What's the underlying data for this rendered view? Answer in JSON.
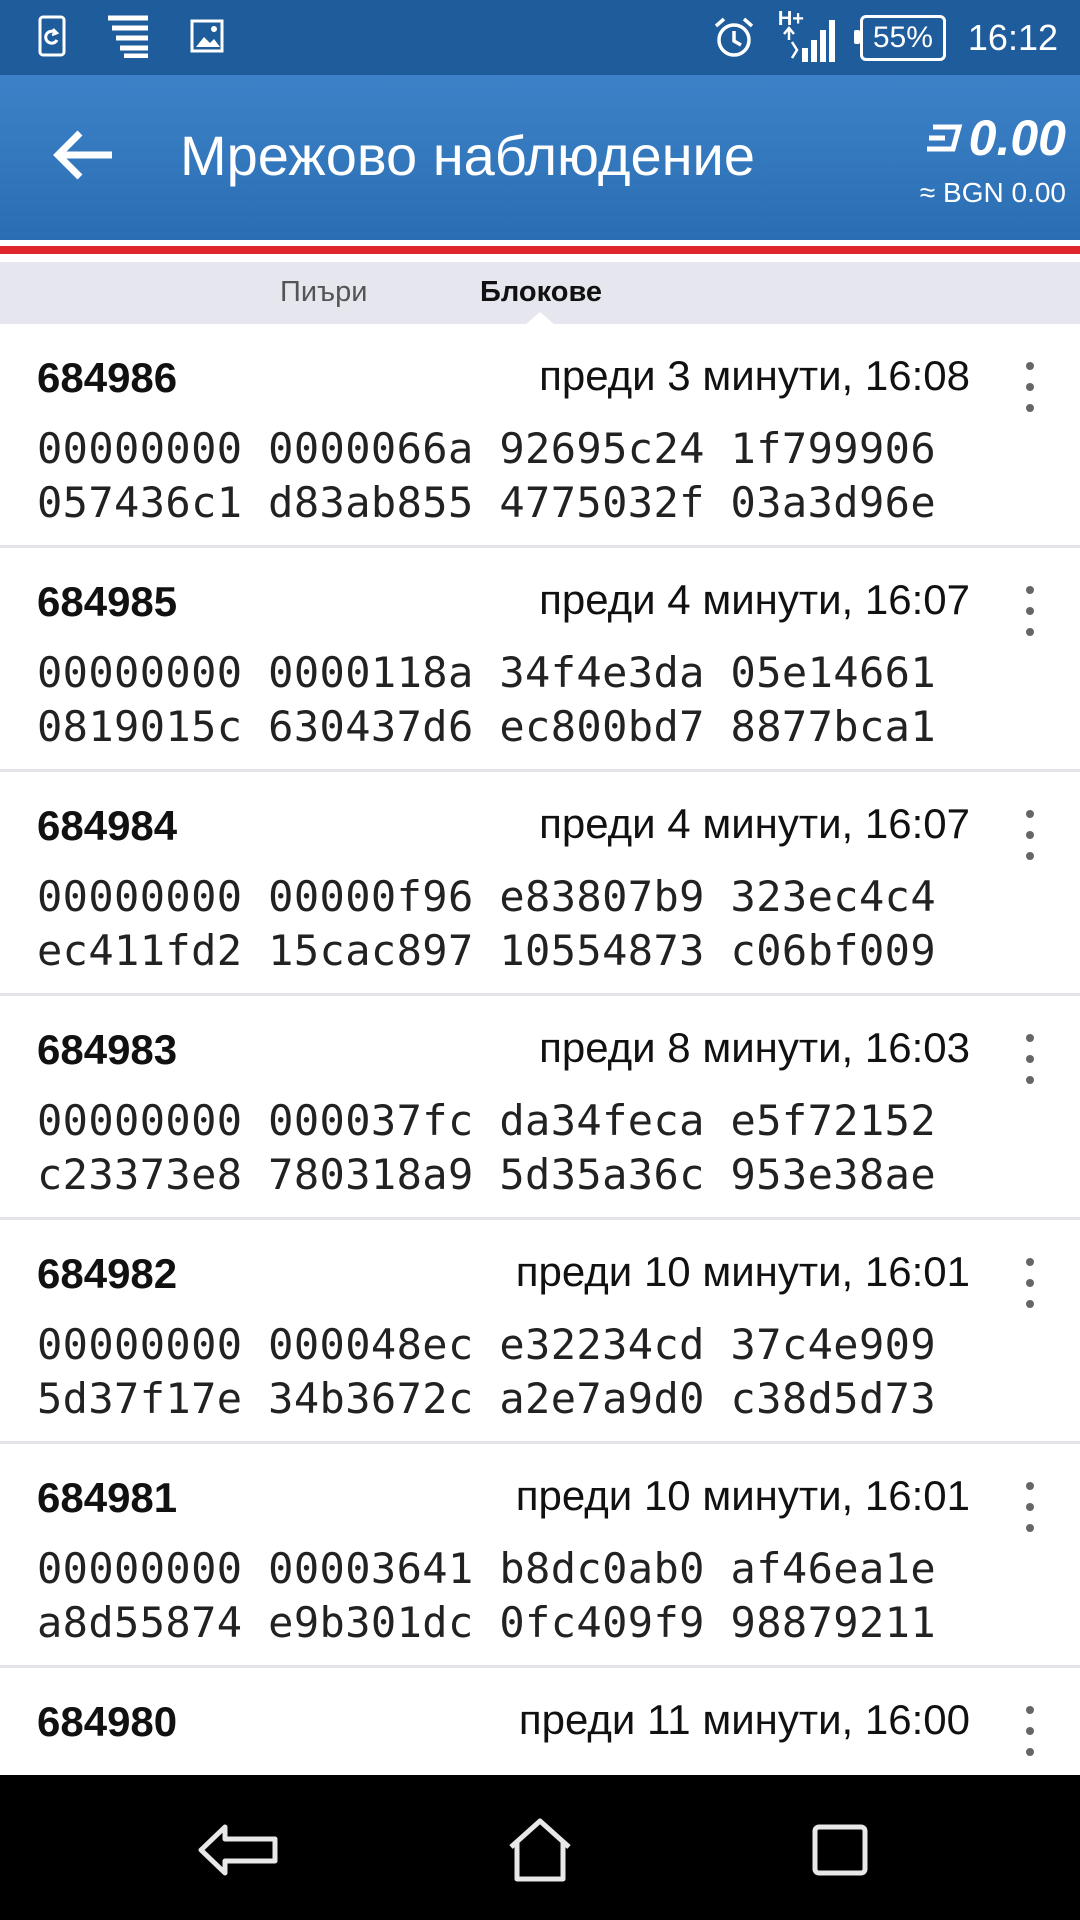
{
  "status_bar": {
    "network_label": "H+",
    "battery": "55%",
    "time": "16:12",
    "icons": [
      "sync-icon",
      "stack-icon",
      "image-icon",
      "alarm-icon",
      "signal-icon",
      "battery-icon"
    ]
  },
  "app_bar": {
    "title": "Мрежово наблюдение",
    "balance": "0.00",
    "balance_fiat": "≈ BGN 0.00"
  },
  "tabs": [
    {
      "label": "Пиъри",
      "selected": false
    },
    {
      "label": "Блокове",
      "selected": true
    }
  ],
  "blocks": [
    {
      "height": "684986",
      "time": "преди 3 минути, 16:08",
      "hash": "00000000 0000066a 92695c24 1f799906\n057436c1 d83ab855 4775032f 03a3d96e"
    },
    {
      "height": "684985",
      "time": "преди 4 минути, 16:07",
      "hash": "00000000 0000118a 34f4e3da 05e14661\n0819015c 630437d6 ec800bd7 8877bca1"
    },
    {
      "height": "684984",
      "time": "преди 4 минути, 16:07",
      "hash": "00000000 00000f96 e83807b9 323ec4c4\nec411fd2 15cac897 10554873 c06bf009"
    },
    {
      "height": "684983",
      "time": "преди 8 минути, 16:03",
      "hash": "00000000 000037fc da34feca e5f72152\nc23373e8 780318a9 5d35a36c 953e38ae"
    },
    {
      "height": "684982",
      "time": "преди 10 минути, 16:01",
      "hash": "00000000 000048ec e32234cd 37c4e909\n5d37f17e 34b3672c a2e7a9d0 c38d5d73"
    },
    {
      "height": "684981",
      "time": "преди 10 минути, 16:01",
      "hash": "00000000 00003641 b8dc0ab0 af46ea1e\na8d55874 e9b301dc 0fc409f9 98879211"
    },
    {
      "height": "684980",
      "time": "преди 11 минути, 16:00",
      "hash": ""
    }
  ],
  "colors": {
    "status_bar": "#1e5c9c",
    "app_bar": "#3d82c8",
    "accent_line": "#e0262b",
    "tab_bar": "#e6e7ee"
  }
}
